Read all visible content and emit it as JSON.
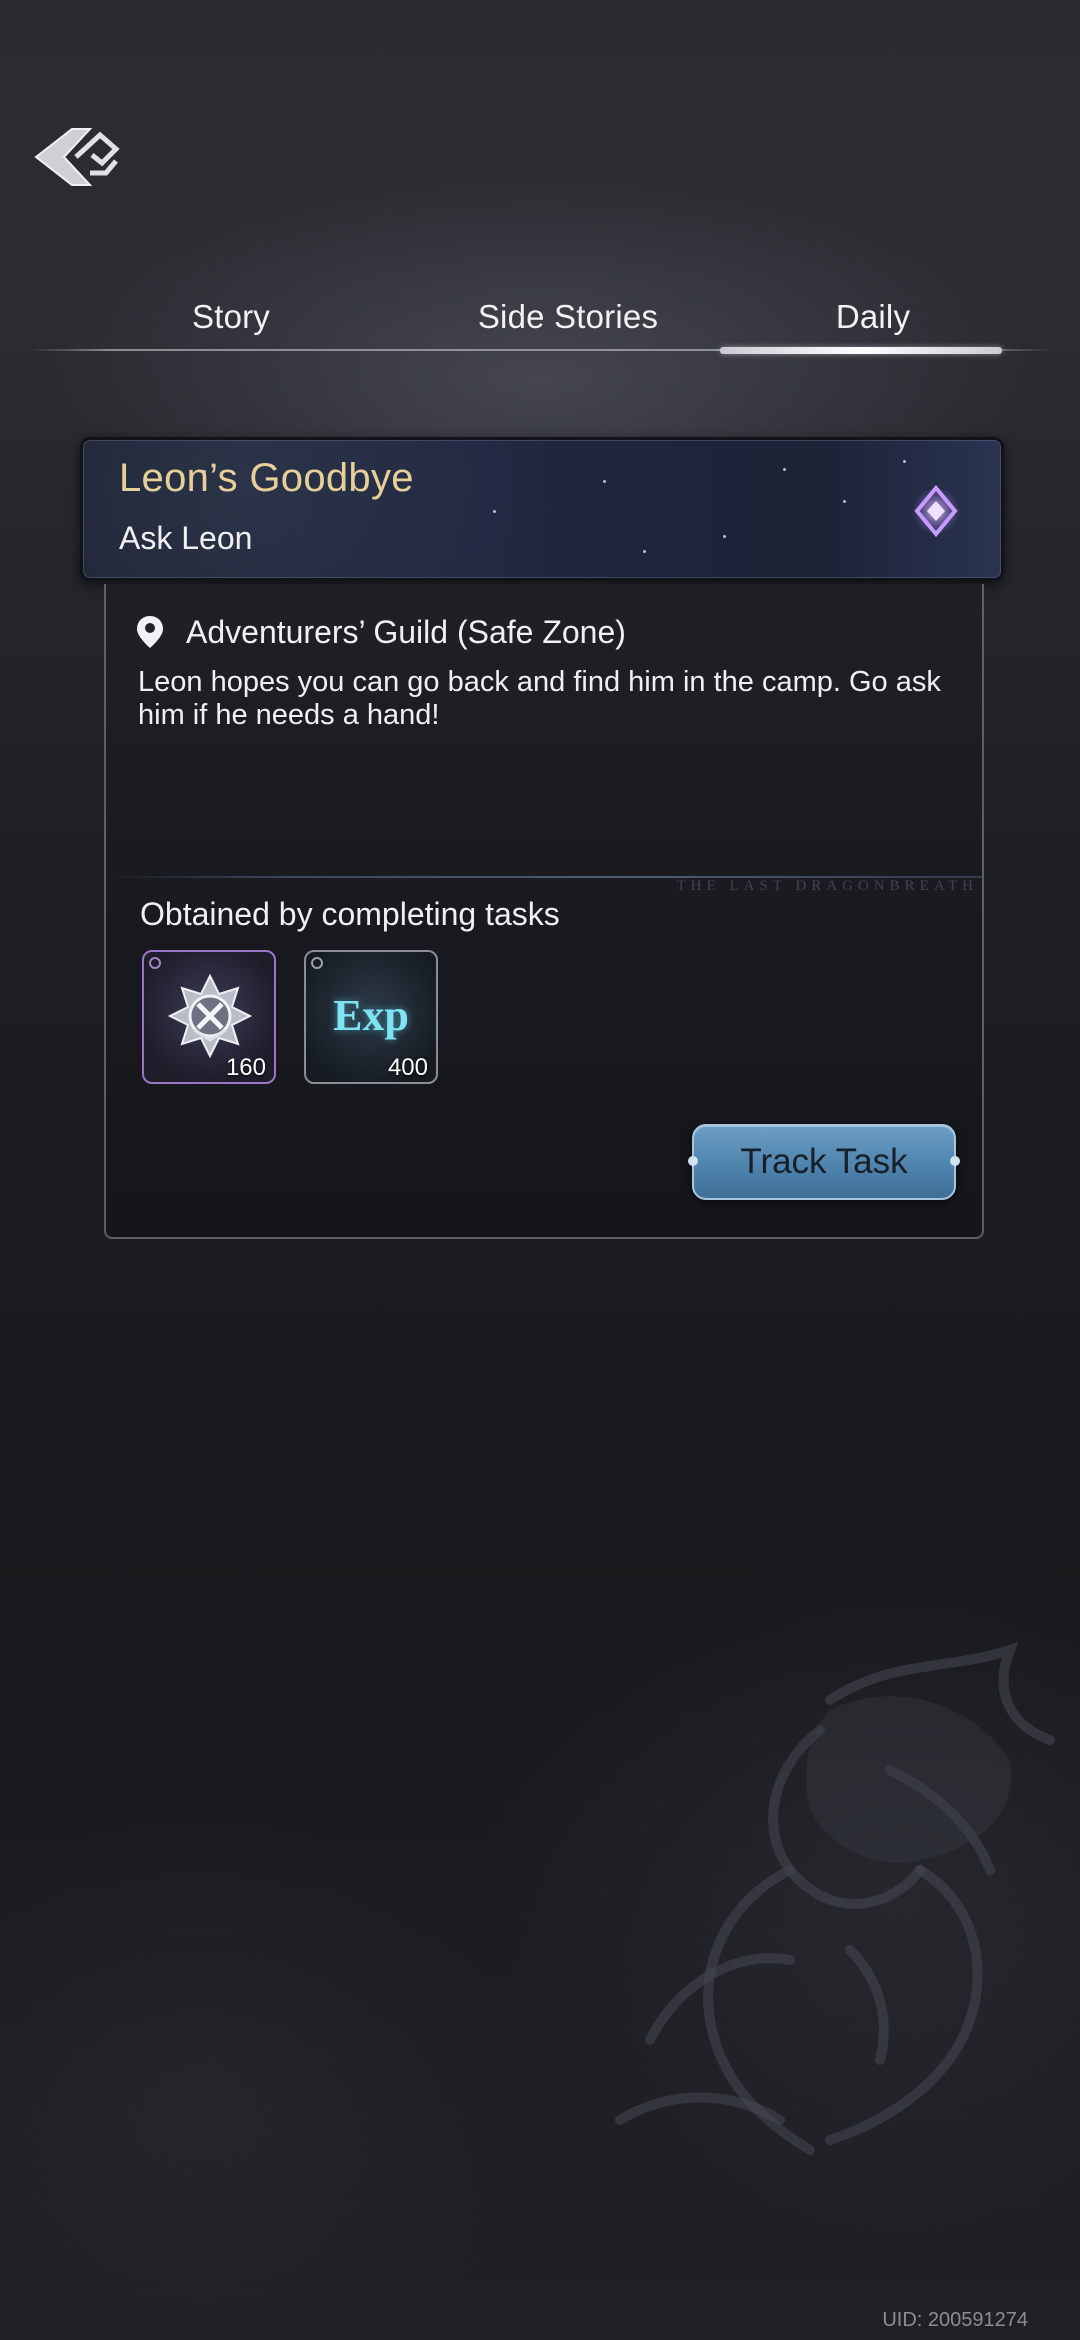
{
  "tabs": [
    {
      "label": "Story"
    },
    {
      "label": "Side Stories"
    },
    {
      "label": "Daily",
      "active": true
    }
  ],
  "quest": {
    "title": "Leon’s Goodbye",
    "subtitle": "Ask Leon",
    "location": "Adventurers’ Guild (Safe Zone)",
    "description": "Leon hopes you can go back and find him in the camp. Go ask him if he needs a hand!",
    "watermark": "THE LAST DRAGONBREATH",
    "rewards_label": "Obtained by completing tasks",
    "rewards": [
      {
        "icon": "emblem-icon",
        "count": "160"
      },
      {
        "icon": "exp-icon",
        "label": "Exp",
        "count": "400"
      }
    ],
    "track_label": "Track Task"
  },
  "uid": "UID: 200591274",
  "colors": {
    "title_gold": "#e7cf9a",
    "button_blue": "#4f84ad",
    "emblem_border": "#9a77c4",
    "exp_cyan": "#7fe3f2"
  }
}
